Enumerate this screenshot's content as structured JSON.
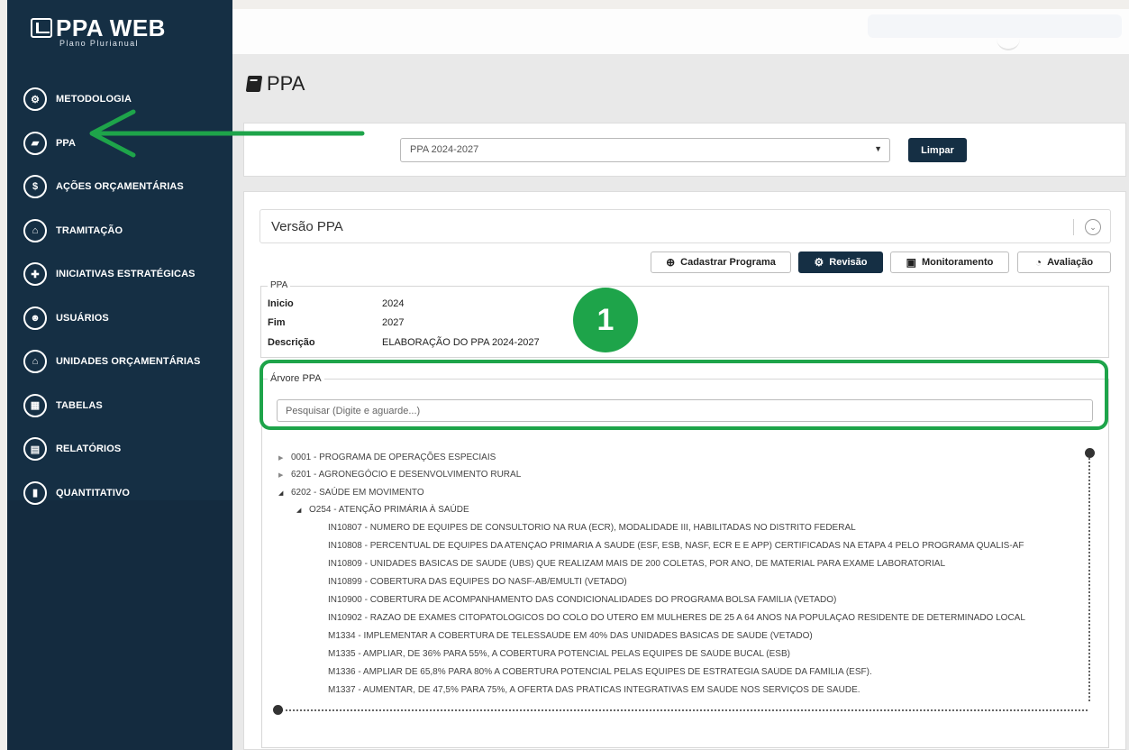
{
  "brand": {
    "title": "PPA WEB",
    "subtitle": "Plano Plurianual"
  },
  "sidebar": {
    "items": [
      {
        "label": "METODOLOGIA",
        "icon": "gears-icon",
        "glyph": "⚙"
      },
      {
        "label": "PPA",
        "icon": "book-icon",
        "glyph": "▰"
      },
      {
        "label": "AÇÕES ORÇAMENTÁRIAS",
        "icon": "dollar-icon",
        "glyph": "$"
      },
      {
        "label": "TRAMITAÇÃO",
        "icon": "inbox-icon",
        "glyph": "⌂"
      },
      {
        "label": "INICIATIVAS ESTRATÉGICAS",
        "icon": "puzzle-icon",
        "glyph": "✚"
      },
      {
        "label": "USUÁRIOS",
        "icon": "users-icon",
        "glyph": "☻"
      },
      {
        "label": "UNIDADES ORÇAMENTÁRIAS",
        "icon": "bank-icon",
        "glyph": "⌂"
      },
      {
        "label": "TABELAS",
        "icon": "table-icon",
        "glyph": "▦"
      },
      {
        "label": "RELATÓRIOS",
        "icon": "file-icon",
        "glyph": "▤"
      },
      {
        "label": "QUANTITATIVO",
        "icon": "bar-chart-icon",
        "glyph": "▮"
      }
    ]
  },
  "page": {
    "title": "PPA"
  },
  "filter": {
    "selected": "PPA 2024-2027",
    "clear_label": "Limpar"
  },
  "versao": {
    "title": "Versão PPA"
  },
  "actions": {
    "cadastrar": "Cadastrar Programa",
    "revisao": "Revisão",
    "monitoramento": "Monitoramento",
    "avaliacao": "Avaliação"
  },
  "ppa_info": {
    "legend": "PPA",
    "inicio_label": "Inicio",
    "inicio": "2024",
    "fim_label": "Fim",
    "fim": "2027",
    "descricao_label": "Descrição",
    "descricao": "ELABORAÇÃO DO PPA 2024-2027"
  },
  "badge": "1",
  "tree": {
    "legend": "Árvore PPA",
    "search_placeholder": "Pesquisar (Digite e aguarde...)",
    "programs": [
      "0001 - PROGRAMA DE OPERAÇÕES ESPECIAIS",
      "6201 - AGRONEGÓCIO E DESENVOLVIMENTO RURAL",
      "6202 - SAÚDE EM MOVIMENTO"
    ],
    "objective": "O254 - ATENÇÃO PRIMÁRIA À SAÚDE",
    "leaves": [
      "IN10807 - NÚMERO DE EQUIPES DE CONSULTÓRIO NA RUA (ECR), MODALIDADE III, HABILITADAS NO DISTRITO FEDERAL",
      "IN10808 - PERCENTUAL DE EQUIPES DA ATENÇÃO PRIMÁRIA À SAÚDE (ESF, ESB, NASF, ECR E E APP) CERTIFICADAS NA ETAPA 4 PELO PROGRAMA QUALIS-AF",
      "IN10809 - UNIDADES BÁSICAS DE SAÚDE (UBS) QUE REALIZAM MAIS DE 200 COLETAS, POR ANO, DE MATERIAL PARA EXAME LABORATORIAL",
      "IN10899 - COBERTURA DAS EQUIPES DO NASF-AB/EMULTI (VETADO)",
      "IN10900 - COBERTURA DE ACOMPANHAMENTO DAS CONDICIONALIDADES DO PROGRAMA BOLSA FAMÍLIA (VETADO)",
      "IN10902 - RAZÃO DE EXAMES CITOPATOLÓGICOS DO COLO DO ÚTERO EM MULHERES DE 25 A 64 ANOS NA POPULAÇÃO RESIDENTE DE DETERMINADO LOCAL",
      "M1334 - IMPLEMENTAR A COBERTURA DE TELESSAÚDE EM 40% DAS UNIDADES BÁSICAS DE SAÚDE (VETADO)",
      "M1335 - AMPLIAR, DE 36% PARA 55%, A COBERTURA POTENCIAL PELAS EQUIPES DE SAÚDE BUCAL (ESB)",
      "M1336 - AMPLIAR DE 65,8% PARA 80% A COBERTURA POTENCIAL PELAS EQUIPES DE ESTRATÉGIA SAÚDE DA FAMÍLIA (ESF).",
      "M1337 - AUMENTAR, DE 47,5% PARA 75%, A OFERTA DAS PRÁTICAS INTEGRATIVAS EM SAÚDE NOS SERVIÇOS DE SAÚDE."
    ]
  },
  "colors": {
    "sidebar": "#152f44",
    "accent": "#1ea44a",
    "button_dark": "#152f44"
  }
}
